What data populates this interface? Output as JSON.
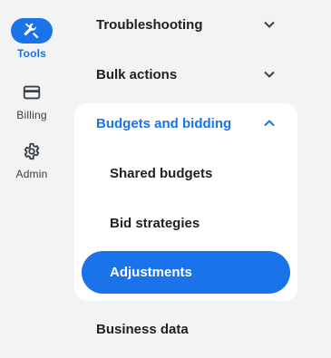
{
  "rail": {
    "items": [
      {
        "label": "Tools",
        "icon": "tools-icon",
        "active": true
      },
      {
        "label": "Billing",
        "icon": "credit-card-icon",
        "active": false
      },
      {
        "label": "Admin",
        "icon": "gear-icon",
        "active": false
      }
    ]
  },
  "menu": {
    "troubleshooting": "Troubleshooting",
    "bulk_actions": "Bulk actions",
    "budgets_and_bidding": "Budgets and bidding",
    "shared_budgets": "Shared budgets",
    "bid_strategies": "Bid strategies",
    "adjustments": "Adjustments",
    "business_data": "Business data"
  },
  "colors": {
    "accent": "#1a73e8",
    "background": "#f1f3f4",
    "card": "#ffffff",
    "text": "#202124"
  }
}
